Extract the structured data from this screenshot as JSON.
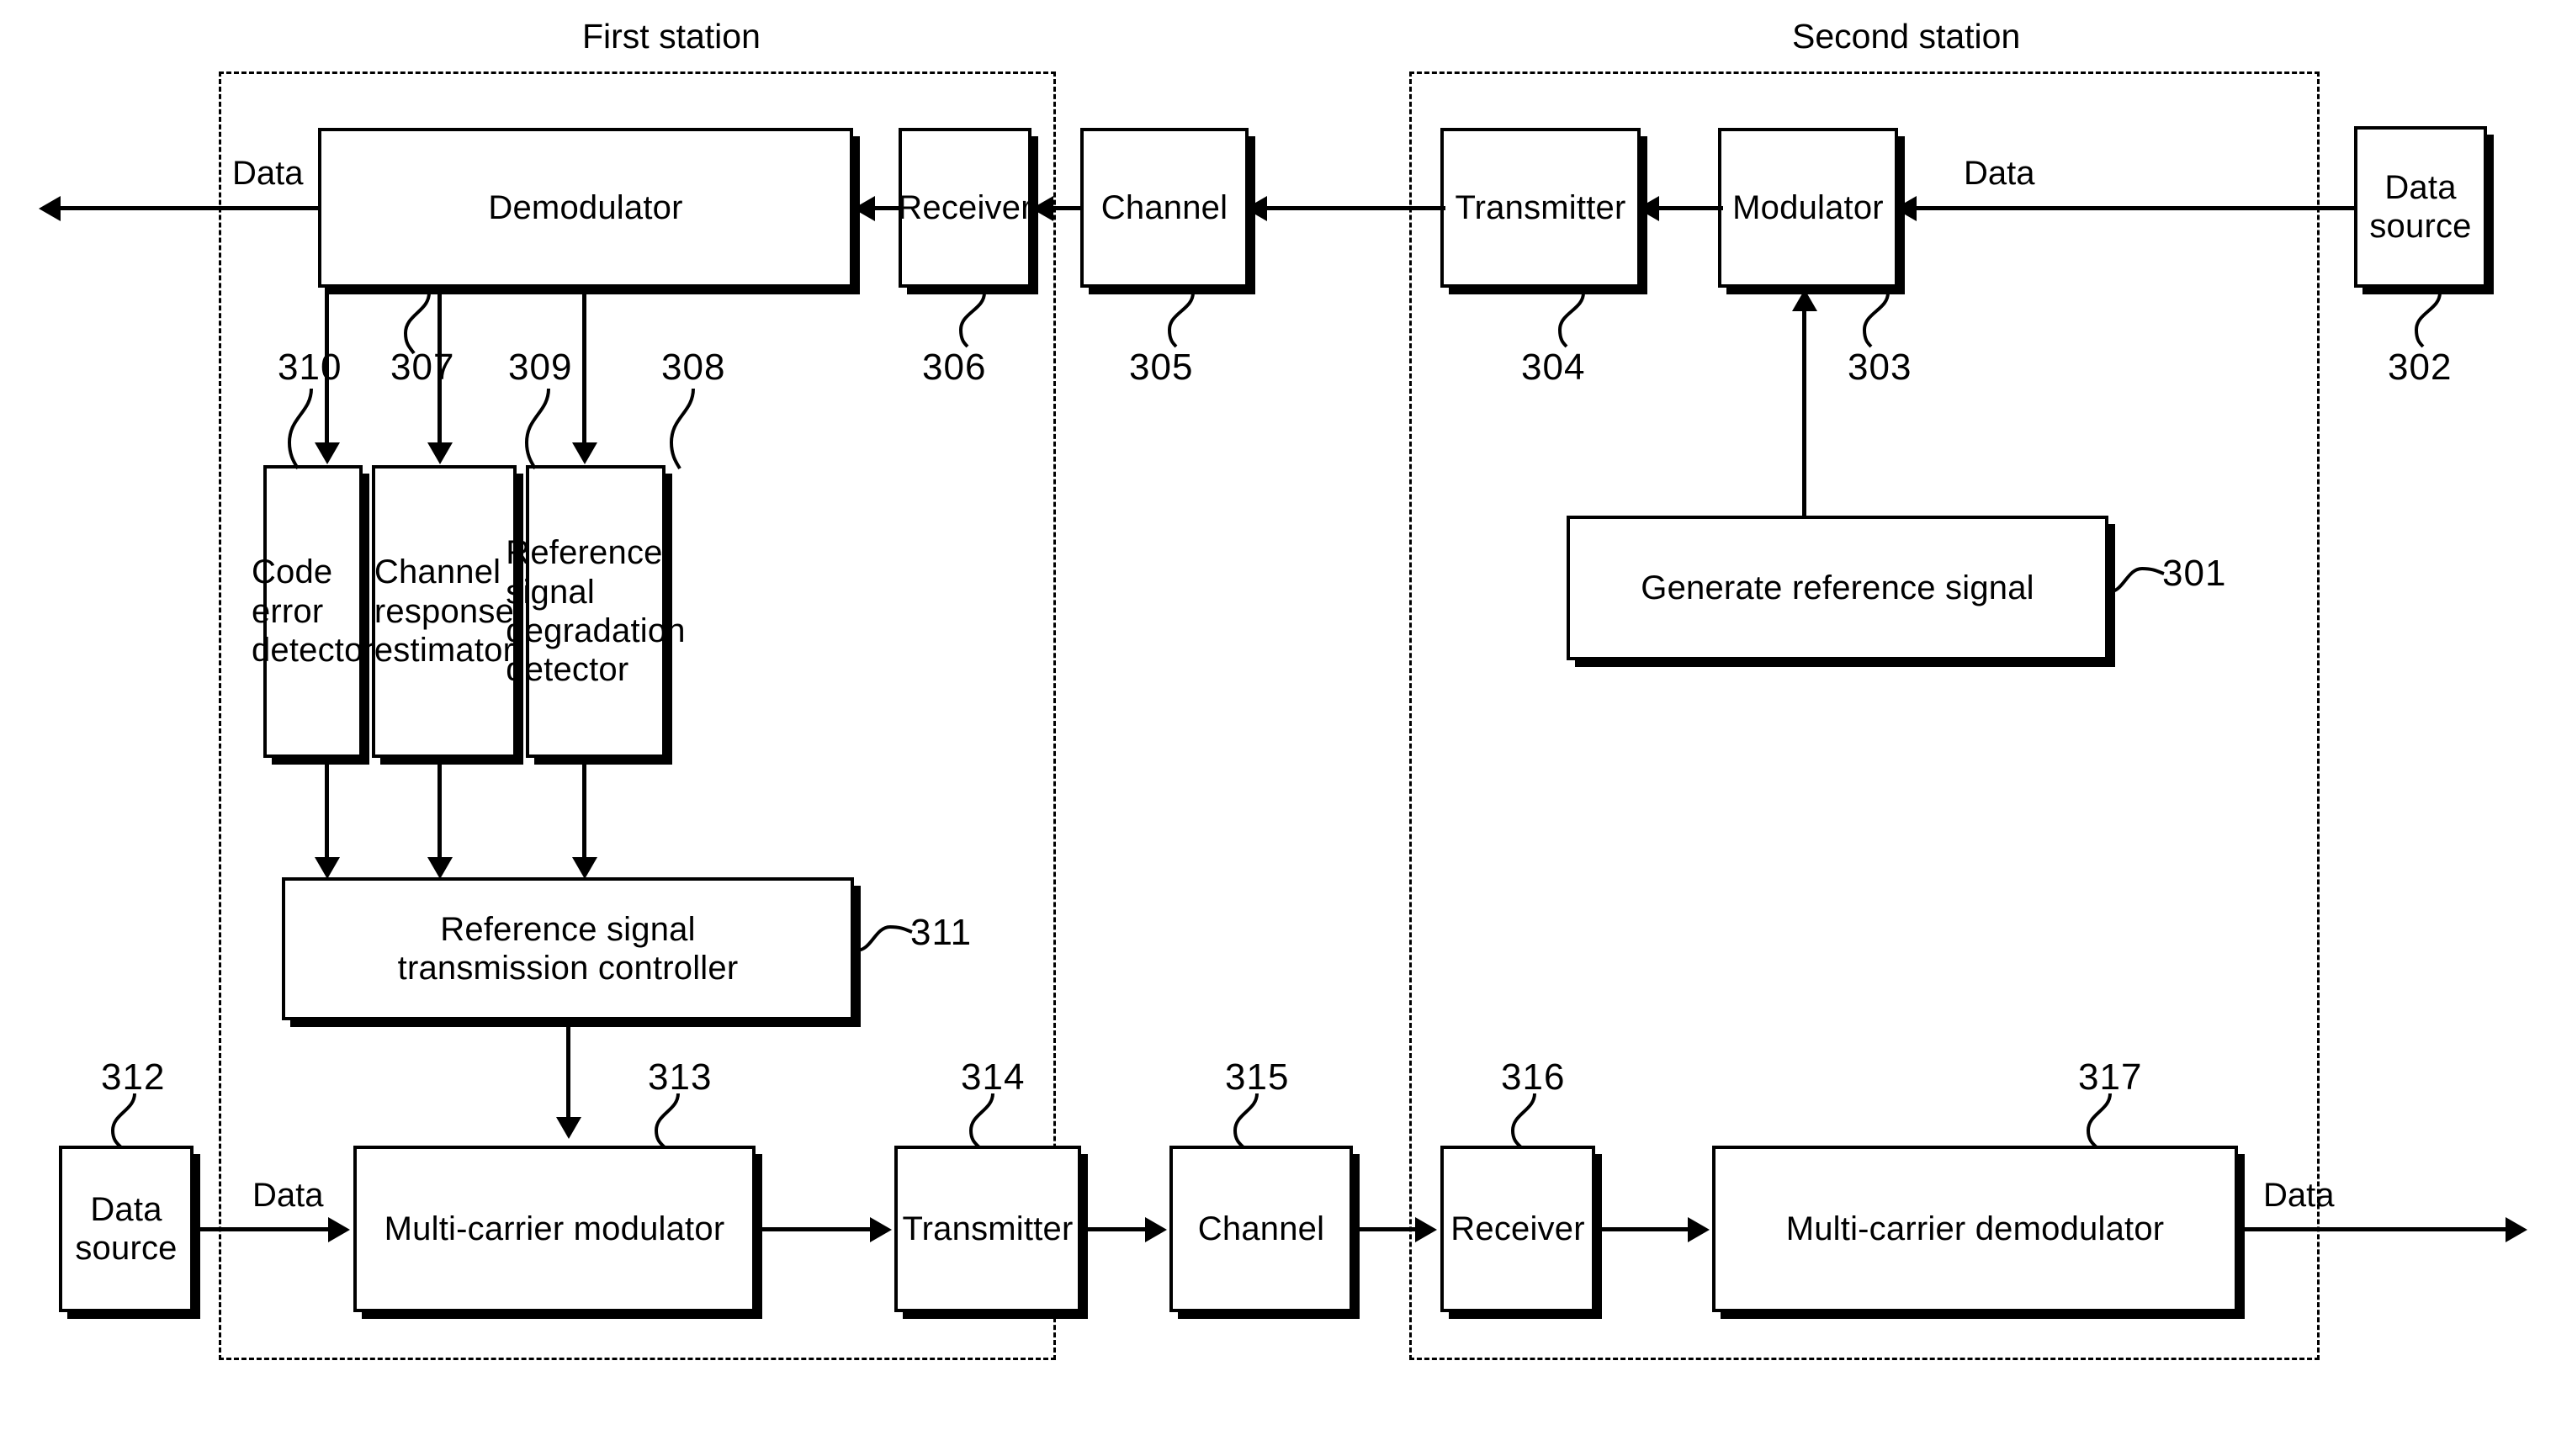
{
  "figure": {
    "stations": [
      {
        "id": "first-station",
        "label": "First station"
      },
      {
        "id": "second-station",
        "label": "Second station"
      }
    ],
    "signal_labels": {
      "demod_out": "Data",
      "modulator_in": "Data",
      "mc_modulator_in": "Data",
      "mc_demod_out": "Data"
    },
    "blocks": [
      {
        "key": "demodulator",
        "label": "Demodulator",
        "ref": "307"
      },
      {
        "key": "receiver_top",
        "label": "Receiver",
        "ref": "306"
      },
      {
        "key": "channel_top",
        "label": "Channel",
        "ref": "305"
      },
      {
        "key": "transmitter_top",
        "label": "Transmitter",
        "ref": "304"
      },
      {
        "key": "modulator",
        "label": "Modulator",
        "ref": "303"
      },
      {
        "key": "data_source_top",
        "label": "Data\nsource",
        "ref": "302"
      },
      {
        "key": "generate_ref_signal",
        "label": "Generate reference signal",
        "ref": "301"
      },
      {
        "key": "code_error_detector",
        "label": "Code\nerror\ndetector",
        "ref": "310"
      },
      {
        "key": "channel_resp_estimator",
        "label": "Channel\nresponse\nestimator",
        "ref": "309"
      },
      {
        "key": "ref_sig_deg_detector",
        "label": "Reference\nsignal\ndegradation\ndetector",
        "ref": "308"
      },
      {
        "key": "ref_sig_tx_controller",
        "label": "Reference signal\ntransmission  controller",
        "ref": "311"
      },
      {
        "key": "data_source_bottom",
        "label": "Data\nsource",
        "ref": "312"
      },
      {
        "key": "mc_modulator",
        "label": "Multi-carrier  modulator",
        "ref": "313"
      },
      {
        "key": "transmitter_bottom",
        "label": "Transmitter",
        "ref": "314"
      },
      {
        "key": "channel_bottom",
        "label": "Channel",
        "ref": "315"
      },
      {
        "key": "receiver_bottom",
        "label": "Receiver",
        "ref": "316"
      },
      {
        "key": "mc_demodulator",
        "label": "Multi-carrier  demodulator",
        "ref": "317"
      }
    ],
    "colors": {
      "line": "#000000",
      "background": "#ffffff"
    }
  }
}
